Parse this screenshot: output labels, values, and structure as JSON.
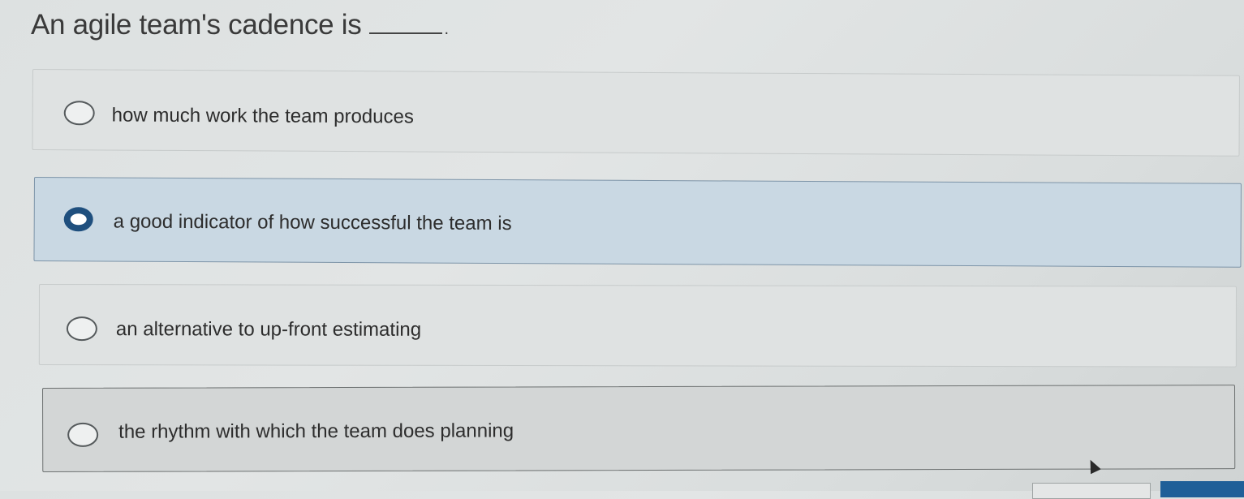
{
  "question": {
    "text": "An agile team's cadence is",
    "blank_end": "."
  },
  "options": [
    {
      "label": "how much work the team produces",
      "selected": false
    },
    {
      "label": "a good indicator of how successful the team is",
      "selected": true
    },
    {
      "label": "an alternative to up-front estimating",
      "selected": false
    },
    {
      "label": "the rhythm with which the team does planning",
      "selected": false
    }
  ],
  "colors": {
    "selected_fill": "#c9d8e3",
    "selected_radio": "#1f4f7e",
    "primary_button": "#1f5f98"
  }
}
